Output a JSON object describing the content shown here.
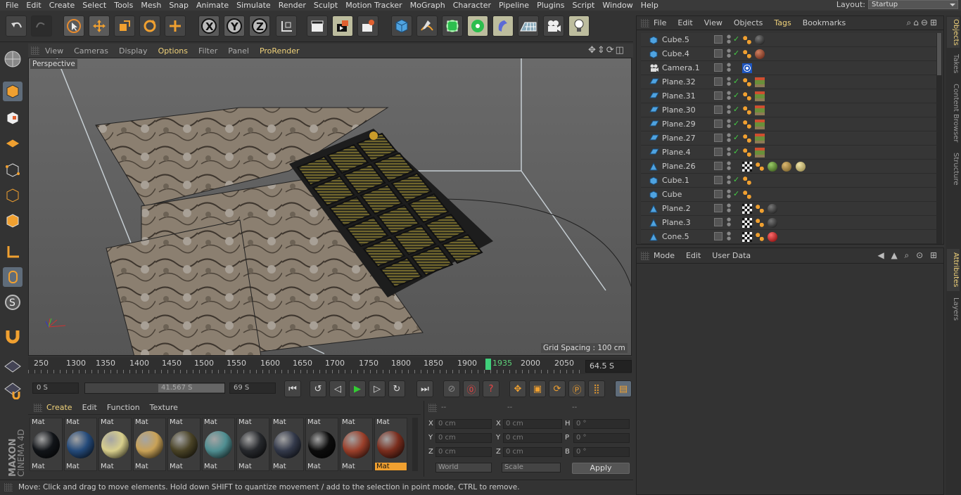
{
  "menubar": {
    "items": [
      "File",
      "Edit",
      "Create",
      "Select",
      "Tools",
      "Mesh",
      "Snap",
      "Animate",
      "Simulate",
      "Render",
      "Sculpt",
      "Motion Tracker",
      "MoGraph",
      "Character",
      "Pipeline",
      "Plugins",
      "Script",
      "Window",
      "Help"
    ],
    "layout_label": "Layout:",
    "layout_value": "Startup"
  },
  "toolbar": {
    "axis_x": "X",
    "axis_y": "Y",
    "axis_z": "Z"
  },
  "viewport": {
    "menu": [
      "View",
      "Cameras",
      "Display",
      "Options",
      "Filter",
      "Panel",
      "ProRender"
    ],
    "highlighted_menu": [
      "Options",
      "ProRender"
    ],
    "label": "Perspective",
    "grid_spacing": "Grid Spacing : 100 cm"
  },
  "timeline": {
    "ticks": [
      "250",
      "1300",
      "1350",
      "1400",
      "1450",
      "1500",
      "1550",
      "1600",
      "1650",
      "1700",
      "1750",
      "1800",
      "1850",
      "1900",
      "1935",
      "2000",
      "2050"
    ],
    "current_frame": "1935",
    "time_readout": "64.5 S"
  },
  "transport": {
    "start": "0 S",
    "range_value": "41.567 S",
    "end": "69 S"
  },
  "materials": {
    "menu": [
      "Create",
      "Edit",
      "Function",
      "Texture"
    ],
    "items": [
      {
        "top": "Mat",
        "bottom": "Mat",
        "color": "#111418"
      },
      {
        "top": "Mat",
        "bottom": "Mat",
        "color": "#244a7a"
      },
      {
        "top": "Mat",
        "bottom": "Mat",
        "color": "#d8cf8c"
      },
      {
        "top": "Mat",
        "bottom": "Mat",
        "color": "#c9a257"
      },
      {
        "top": "Mat",
        "bottom": "Mat",
        "color": "#4a4326"
      },
      {
        "top": "Mat",
        "bottom": "Mat",
        "color": "#4f8e91"
      },
      {
        "top": "Mat",
        "bottom": "Mat",
        "color": "#26282c"
      },
      {
        "top": "Mat",
        "bottom": "Mat",
        "color": "#33394a"
      },
      {
        "top": "Mat",
        "bottom": "Mat",
        "color": "#0c0c0c"
      },
      {
        "top": "Mat",
        "bottom": "Mat",
        "color": "#9a3f2a"
      },
      {
        "top": "Mat",
        "bottom": "Mat",
        "color": "#7a2d1d"
      }
    ]
  },
  "coords": {
    "headers": [
      "--",
      "--",
      "--"
    ],
    "rows": [
      {
        "a": "X",
        "av": "0 cm",
        "b": "X",
        "bv": "0 cm",
        "c": "H",
        "cv": "0 °"
      },
      {
        "a": "Y",
        "av": "0 cm",
        "b": "Y",
        "bv": "0 cm",
        "c": "P",
        "cv": "0 °"
      },
      {
        "a": "Z",
        "av": "0 cm",
        "b": "Z",
        "bv": "0 cm",
        "c": "B",
        "cv": "0 °"
      }
    ],
    "world": "World",
    "scale": "Scale",
    "apply": "Apply"
  },
  "statusbar": {
    "text": "Move: Click and drag to move elements. Hold down SHIFT to quantize movement / add to the selection in point mode, CTRL to remove."
  },
  "objects": {
    "menu": [
      "File",
      "Edit",
      "View",
      "Objects",
      "Tags",
      "Bookmarks"
    ],
    "highlighted_menu": "Tags",
    "rows": [
      {
        "name": "Cube.5",
        "icon": "cube",
        "check": true,
        "tags": [
          "phong",
          "mat-dark"
        ]
      },
      {
        "name": "Cube.4",
        "icon": "cube",
        "check": true,
        "tags": [
          "phong",
          "mat-rust"
        ]
      },
      {
        "name": "Camera.1",
        "icon": "camera",
        "check": false,
        "tags": [
          "target"
        ]
      },
      {
        "name": "Plane.32",
        "icon": "plane",
        "check": true,
        "tags": [
          "phong",
          "mat-terrain"
        ]
      },
      {
        "name": "Plane.31",
        "icon": "plane",
        "check": true,
        "tags": [
          "phong",
          "mat-terrain"
        ]
      },
      {
        "name": "Plane.30",
        "icon": "plane",
        "check": true,
        "tags": [
          "phong",
          "mat-terrain"
        ]
      },
      {
        "name": "Plane.29",
        "icon": "plane",
        "check": true,
        "tags": [
          "phong",
          "mat-terrain"
        ]
      },
      {
        "name": "Plane.27",
        "icon": "plane",
        "check": true,
        "tags": [
          "phong",
          "mat-terrain"
        ]
      },
      {
        "name": "Plane.4",
        "icon": "plane",
        "check": true,
        "tags": [
          "phong",
          "mat-terrain"
        ]
      },
      {
        "name": "Plane.26",
        "icon": "poly",
        "check": false,
        "tags": [
          "uvw",
          "phong",
          "mat-green",
          "mat-olive",
          "mat-sand"
        ]
      },
      {
        "name": "Cube.1",
        "icon": "cube",
        "check": true,
        "tags": [
          "phong"
        ]
      },
      {
        "name": "Cube",
        "icon": "cube",
        "check": true,
        "tags": [
          "phong"
        ]
      },
      {
        "name": "Plane.2",
        "icon": "poly",
        "check": false,
        "tags": [
          "uvw",
          "phong",
          "mat-dark"
        ]
      },
      {
        "name": "Plane.3",
        "icon": "poly",
        "check": false,
        "tags": [
          "uvw",
          "phong",
          "mat-dark"
        ]
      },
      {
        "name": "Cone.5",
        "icon": "poly",
        "check": false,
        "tags": [
          "uvw",
          "phong",
          "mat-red"
        ]
      }
    ]
  },
  "attributes": {
    "menu": [
      "Mode",
      "Edit",
      "User Data"
    ]
  },
  "sidetabs": {
    "top": [
      "Objects",
      "Takes",
      "Content Browser",
      "Structure"
    ],
    "bottom": [
      "Attributes",
      "Layers"
    ]
  },
  "branding": {
    "vendor": "MAXON",
    "product": "CINEMA 4D"
  }
}
